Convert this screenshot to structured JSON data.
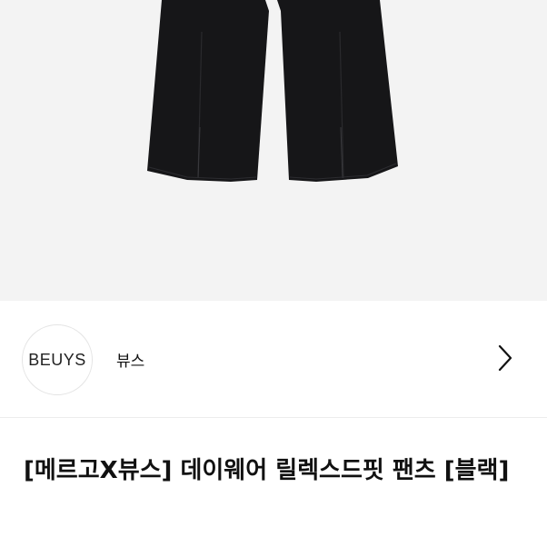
{
  "product": {
    "image_alt": "black wide pants",
    "title": "[메르고X뷰스] 데이웨어 릴렉스드핏 팬츠 [블랙]"
  },
  "brand": {
    "logo_text": "BEUYS",
    "name": "뷰스"
  },
  "icons": {
    "chevron": "chevron-right-icon"
  },
  "colors": {
    "image_background": "#f3f3f3",
    "pants": "#161618",
    "text": "#111111"
  }
}
